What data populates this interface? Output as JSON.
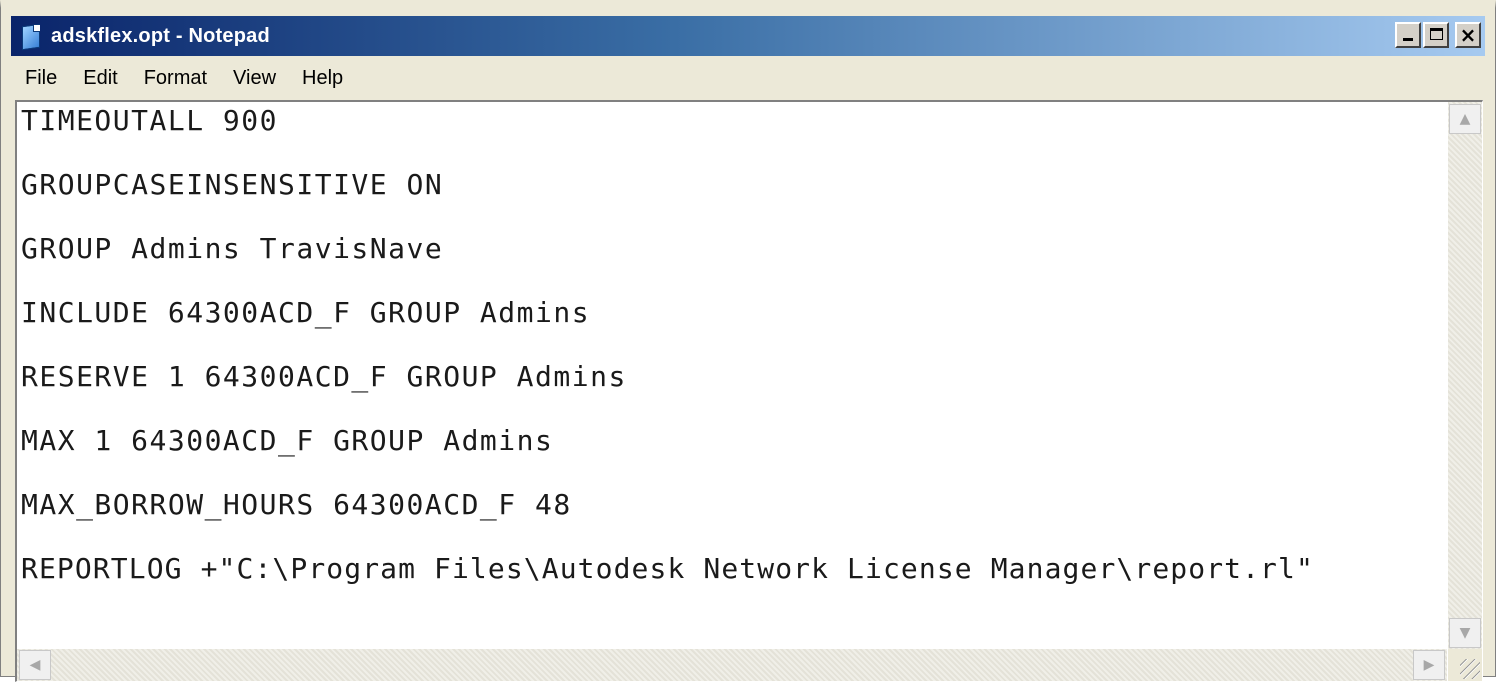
{
  "window": {
    "title": "adskflex.opt - Notepad",
    "icon": "notepad-icon"
  },
  "title_buttons": {
    "minimize": "minimize-icon",
    "maximize": "maximize-icon",
    "close": "×"
  },
  "menu": {
    "items": [
      "File",
      "Edit",
      "Format",
      "View",
      "Help"
    ]
  },
  "document": {
    "lines": [
      "TIMEOUTALL 900",
      "GROUPCASEINSENSITIVE ON",
      "GROUP Admins TravisNave",
      "INCLUDE 64300ACD_F GROUP Admins",
      "RESERVE 1 64300ACD_F GROUP Admins",
      "MAX 1 64300ACD_F GROUP Admins",
      "MAX_BORROW_HOURS 64300ACD_F 48",
      "REPORTLOG +\"C:\\Program Files\\Autodesk Network License Manager\\report.rl\""
    ]
  },
  "scrollbar": {
    "up": "▲",
    "down": "▼",
    "left": "◀",
    "right": "▶"
  },
  "colors": {
    "title_start": "#0a246a",
    "title_end": "#a6caf0",
    "chrome": "#ece9d8"
  }
}
